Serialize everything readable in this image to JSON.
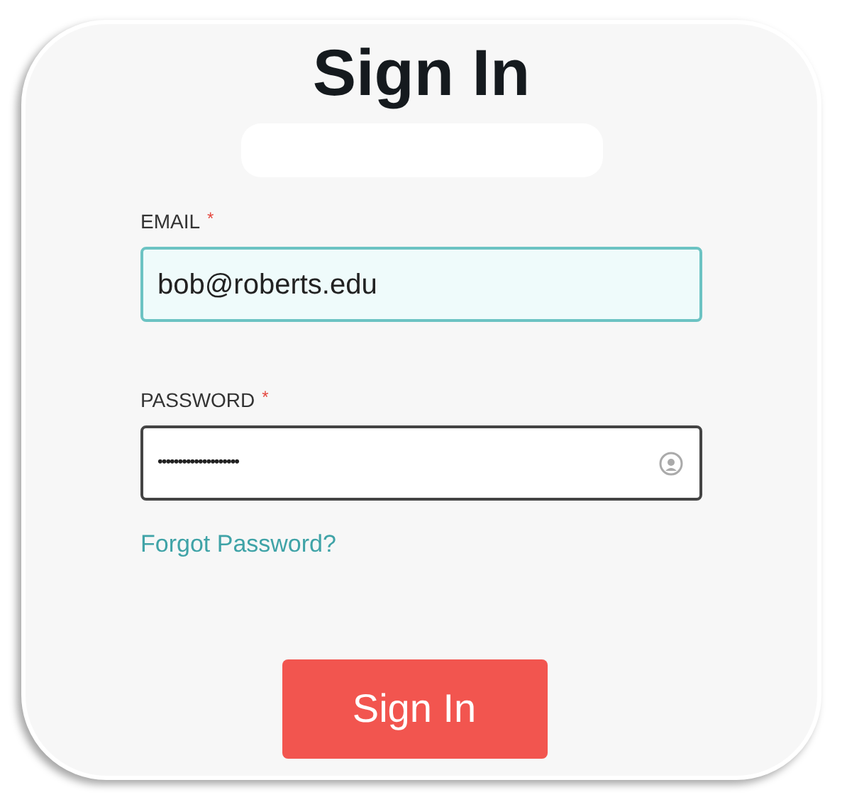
{
  "title": "Sign In",
  "fields": [
    {
      "label": "EMAIL",
      "required_mark": "*",
      "kind": "text",
      "value": "bob@roberts.edu",
      "focused": true
    },
    {
      "label": "PASSWORD",
      "required_mark": "*",
      "kind": "password",
      "value": "••••••••••••••••••••",
      "focused": false
    }
  ],
  "forgot_link": "Forgot Password?",
  "submit_button": "Sign In"
}
